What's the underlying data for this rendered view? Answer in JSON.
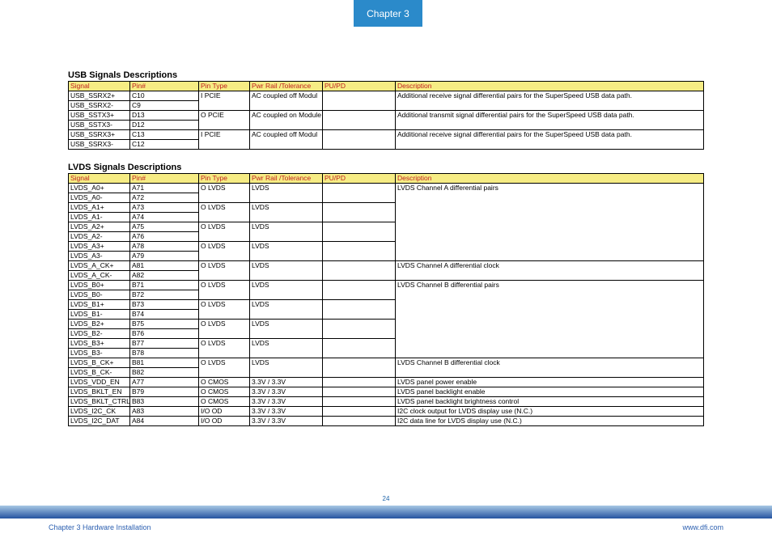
{
  "chapter": "Chapter 3",
  "pageNum": "24",
  "footerLeft": "Chapter 3 Hardware Installation",
  "footerRight": "www.dfi.com",
  "usb": {
    "title": "USB Signals Descriptions",
    "headers": [
      "Signal",
      "Pin#",
      "Pin Type",
      "Pwr Rail /Tolerance",
      "PU/PD",
      "Description"
    ],
    "rows": [
      {
        "signal": "USB_SSRX2+",
        "pin": "C10",
        "type": "I PCIE",
        "pwr": "AC coupled off Modul",
        "pupd": "",
        "desc": "Additional receive signal differential pairs for the SuperSpeed USB data path.",
        "mergeDown": true
      },
      {
        "signal": "USB_SSRX2-",
        "pin": "C9",
        "type": "",
        "pwr": "",
        "pupd": "",
        "desc": "",
        "merged": true
      },
      {
        "signal": "USB_SSTX3+",
        "pin": "D13",
        "type": "O PCIE",
        "pwr": "AC coupled on Module",
        "pupd": "",
        "desc": "Additional transmit signal differential pairs for the SuperSpeed USB data path.",
        "mergeDown": true
      },
      {
        "signal": "USB_SSTX3-",
        "pin": "D12",
        "type": "",
        "pwr": "",
        "pupd": "",
        "desc": "",
        "merged": true
      },
      {
        "signal": "USB_SSRX3+",
        "pin": "C13",
        "type": "I PCIE",
        "pwr": "AC coupled off Modul",
        "pupd": "",
        "desc": "Additional receive signal differential pairs for the SuperSpeed USB data path.",
        "mergeDown": true
      },
      {
        "signal": "USB_SSRX3-",
        "pin": "C12",
        "type": "",
        "pwr": "",
        "pupd": "",
        "desc": "",
        "merged": true
      }
    ]
  },
  "lvds": {
    "title": "LVDS Signals Descriptions",
    "headers": [
      "Signal",
      "Pin#",
      "Pin Type",
      "Pwr Rail /Tolerance",
      "PU/PD",
      "Description"
    ],
    "rows": [
      {
        "signal": "LVDS_A0+",
        "pin": "A71",
        "type": "O LVDS",
        "pwr": "LVDS",
        "pupd": "",
        "desc": "LVDS Channel A differential pairs",
        "mergeDown": true
      },
      {
        "signal": "LVDS_A0-",
        "pin": "A72",
        "type": "",
        "pwr": "",
        "pupd": "",
        "desc": "",
        "merged": true
      },
      {
        "signal": "LVDS_A1+",
        "pin": "A73",
        "type": "O LVDS",
        "pwr": "LVDS",
        "pupd": "",
        "desc": "",
        "mergeDown": true,
        "descMerged": true
      },
      {
        "signal": "LVDS_A1-",
        "pin": "A74",
        "type": "",
        "pwr": "",
        "pupd": "",
        "desc": "",
        "merged": true,
        "descMerged": true
      },
      {
        "signal": "LVDS_A2+",
        "pin": "A75",
        "type": "O LVDS",
        "pwr": "LVDS",
        "pupd": "",
        "desc": "",
        "mergeDown": true,
        "descMerged": true
      },
      {
        "signal": "LVDS_A2-",
        "pin": "A76",
        "type": "",
        "pwr": "",
        "pupd": "",
        "desc": "",
        "merged": true,
        "descMerged": true
      },
      {
        "signal": "LVDS_A3+",
        "pin": "A78",
        "type": "O LVDS",
        "pwr": "LVDS",
        "pupd": "",
        "desc": "",
        "mergeDown": true,
        "descMerged": true
      },
      {
        "signal": "LVDS_A3-",
        "pin": "A79",
        "type": "",
        "pwr": "",
        "pupd": "",
        "desc": "",
        "merged": true,
        "descMerged": true
      },
      {
        "signal": "LVDS_A_CK+",
        "pin": "A81",
        "type": "O LVDS",
        "pwr": "LVDS",
        "pupd": "",
        "desc": "LVDS Channel A differential clock",
        "mergeDown": true
      },
      {
        "signal": "LVDS_A_CK-",
        "pin": "A82",
        "type": "",
        "pwr": "",
        "pupd": "",
        "desc": "",
        "merged": true
      },
      {
        "signal": "LVDS_B0+",
        "pin": "B71",
        "type": "O LVDS",
        "pwr": "LVDS",
        "pupd": "",
        "desc": "LVDS Channel B differential pairs",
        "mergeDown": true
      },
      {
        "signal": "LVDS_B0-",
        "pin": "B72",
        "type": "",
        "pwr": "",
        "pupd": "",
        "desc": "",
        "merged": true
      },
      {
        "signal": "LVDS_B1+",
        "pin": "B73",
        "type": "O LVDS",
        "pwr": "LVDS",
        "pupd": "",
        "desc": "",
        "mergeDown": true,
        "descMerged": true
      },
      {
        "signal": "LVDS_B1-",
        "pin": "B74",
        "type": "",
        "pwr": "",
        "pupd": "",
        "desc": "",
        "merged": true,
        "descMerged": true
      },
      {
        "signal": "LVDS_B2+",
        "pin": "B75",
        "type": "O LVDS",
        "pwr": "LVDS",
        "pupd": "",
        "desc": "",
        "mergeDown": true,
        "descMerged": true
      },
      {
        "signal": "LVDS_B2-",
        "pin": "B76",
        "type": "",
        "pwr": "",
        "pupd": "",
        "desc": "",
        "merged": true,
        "descMerged": true
      },
      {
        "signal": "LVDS_B3+",
        "pin": "B77",
        "type": "O LVDS",
        "pwr": "LVDS",
        "pupd": "",
        "desc": "",
        "mergeDown": true,
        "descMerged": true
      },
      {
        "signal": "LVDS_B3-",
        "pin": "B78",
        "type": "",
        "pwr": "",
        "pupd": "",
        "desc": "",
        "merged": true,
        "descMerged": true
      },
      {
        "signal": "LVDS_B_CK+",
        "pin": "B81",
        "type": "O LVDS",
        "pwr": "LVDS",
        "pupd": "",
        "desc": "LVDS Channel B differential clock",
        "mergeDown": true
      },
      {
        "signal": "LVDS_B_CK-",
        "pin": "B82",
        "type": "",
        "pwr": "",
        "pupd": "",
        "desc": "",
        "merged": true
      },
      {
        "signal": "LVDS_VDD_EN",
        "pin": "A77",
        "type": "O CMOS",
        "pwr": "3.3V / 3.3V",
        "pupd": "",
        "desc": "LVDS panel power enable"
      },
      {
        "signal": "LVDS_BKLT_EN",
        "pin": "B79",
        "type": "O CMOS",
        "pwr": "3.3V / 3.3V",
        "pupd": "",
        "desc": "LVDS panel backlight enable"
      },
      {
        "signal": "LVDS_BKLT_CTRL",
        "pin": "B83",
        "type": "O CMOS",
        "pwr": "3.3V / 3.3V",
        "pupd": "",
        "desc": "LVDS panel backlight brightness control"
      },
      {
        "signal": "LVDS_I2C_CK",
        "pin": "A83",
        "type": "I/O OD",
        "pwr": "3.3V / 3.3V",
        "pupd": "",
        "desc": "I2C clock output for LVDS display use (N.C.)"
      },
      {
        "signal": "LVDS_I2C_DAT",
        "pin": "A84",
        "type": "I/O OD",
        "pwr": "3.3V / 3.3V",
        "pupd": "",
        "desc": "I2C data line for LVDS display use (N.C.)"
      }
    ]
  }
}
